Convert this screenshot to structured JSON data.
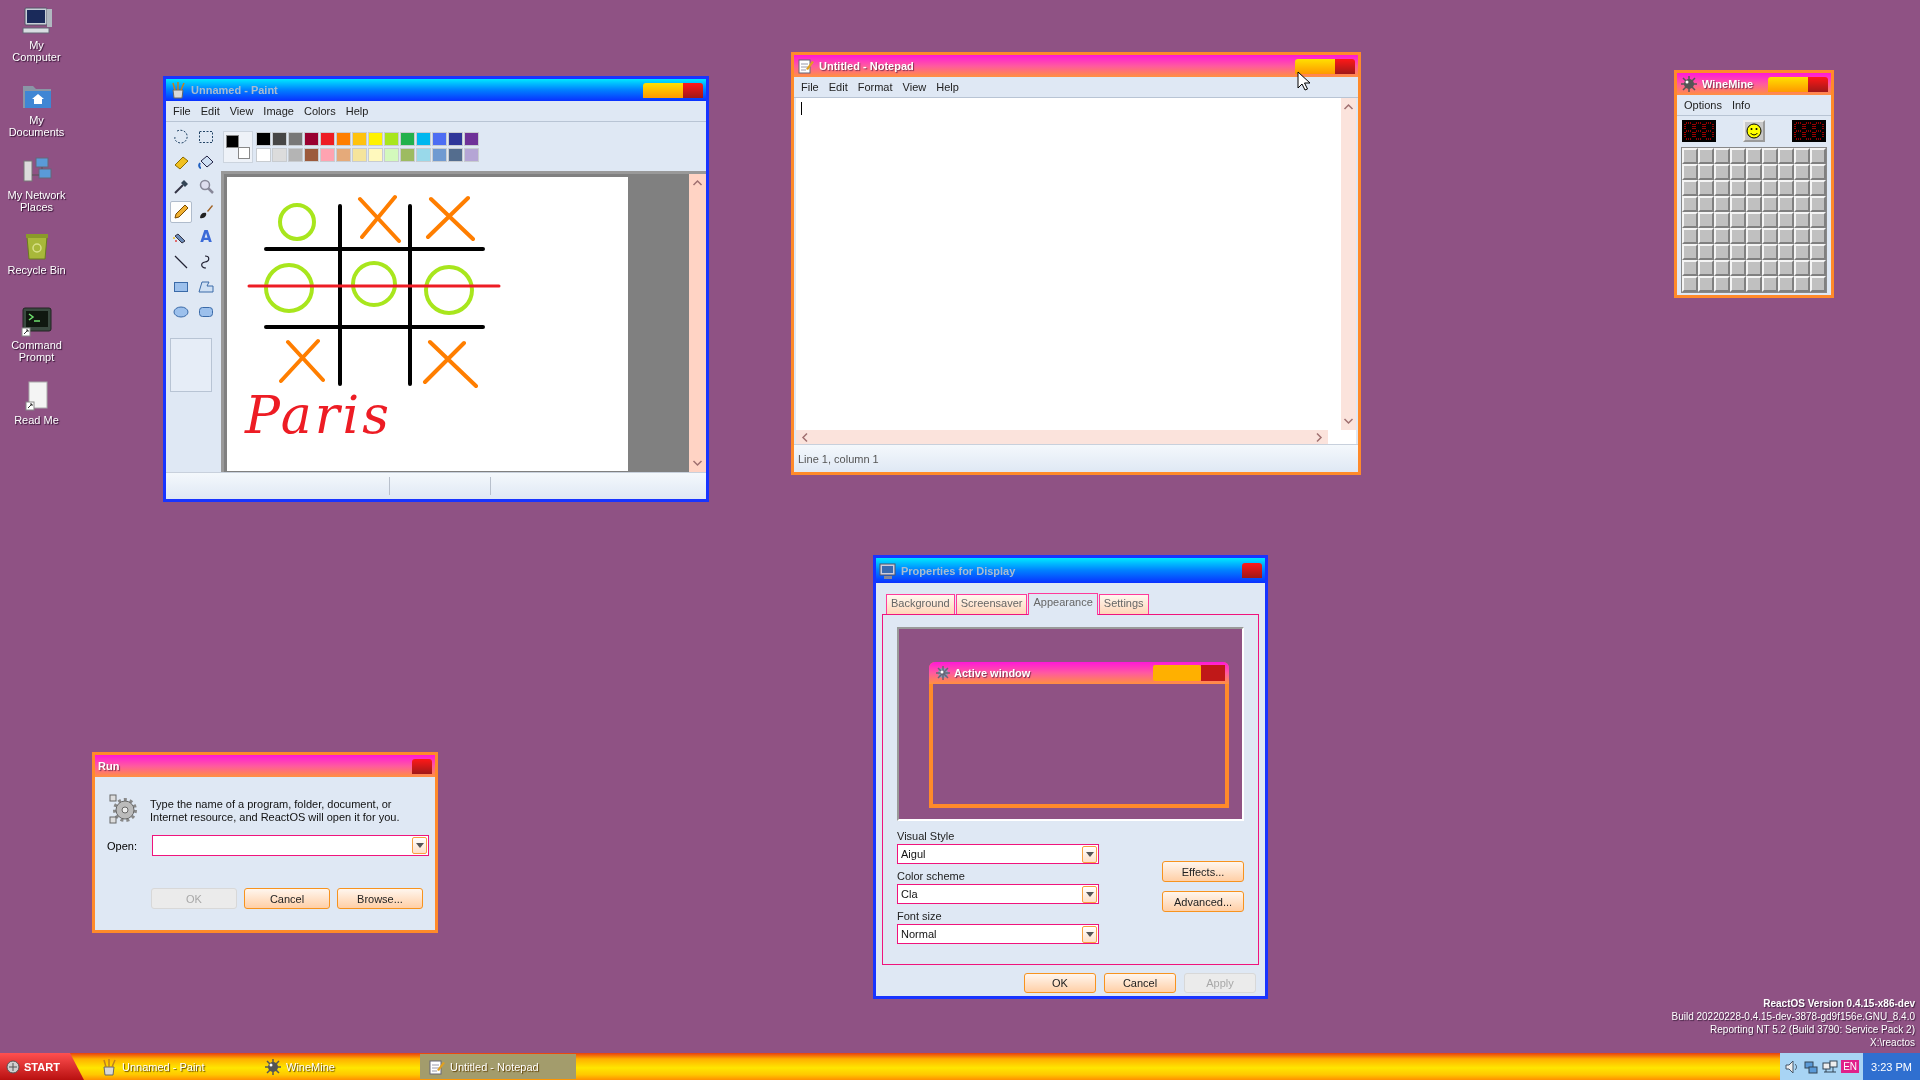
{
  "desktop_icons": [
    {
      "label": "My Computer",
      "kind": "computer"
    },
    {
      "label": "My Documents",
      "kind": "documents"
    },
    {
      "label": "My Network Places",
      "kind": "network"
    },
    {
      "label": "Recycle Bin",
      "kind": "recycle"
    },
    {
      "label": "Command Prompt",
      "kind": "terminal"
    },
    {
      "label": "Read Me",
      "kind": "readme"
    }
  ],
  "windows": [
    {
      "kind": "paint",
      "title": "Unnamed - Paint",
      "active": false,
      "minimize_maximize": true,
      "menu": [
        "File",
        "Edit",
        "View",
        "Image",
        "Colors",
        "Help"
      ],
      "tools": [
        {
          "kind": "free-select",
          "selected": false
        },
        {
          "kind": "rect-select",
          "selected": false
        },
        {
          "kind": "eraser",
          "selected": false
        },
        {
          "kind": "fill",
          "selected": false
        },
        {
          "kind": "picker",
          "selected": false
        },
        {
          "kind": "magnifier",
          "selected": false
        },
        {
          "kind": "pencil",
          "selected": true
        },
        {
          "kind": "brush",
          "selected": false
        },
        {
          "kind": "airbrush",
          "selected": false
        },
        {
          "kind": "text",
          "label": "A",
          "selected": false
        },
        {
          "kind": "line",
          "selected": false
        },
        {
          "kind": "curve",
          "selected": false
        },
        {
          "kind": "rectangle",
          "selected": false
        },
        {
          "kind": "polygon",
          "selected": false
        },
        {
          "kind": "ellipse",
          "selected": false
        },
        {
          "kind": "rounded-rectangle",
          "selected": false
        }
      ],
      "current_colors": [
        {
          "color": "#000000"
        },
        {
          "color": "#ffffff"
        }
      ],
      "palette": [
        {
          "color": "#000000"
        },
        {
          "color": "#464646"
        },
        {
          "color": "#787878"
        },
        {
          "color": "#990030"
        },
        {
          "color": "#ed1c24"
        },
        {
          "color": "#ff7e00"
        },
        {
          "color": "#ffc20e"
        },
        {
          "color": "#fff200"
        },
        {
          "color": "#a8e61d"
        },
        {
          "color": "#22b14c"
        },
        {
          "color": "#00b7ef"
        },
        {
          "color": "#4d6df3"
        },
        {
          "color": "#2f3699"
        },
        {
          "color": "#6f3198"
        },
        {
          "color": "#ffffff"
        },
        {
          "color": "#dcdcdc"
        },
        {
          "color": "#b4b4b4"
        },
        {
          "color": "#9c5a3c"
        },
        {
          "color": "#ffa3b1"
        },
        {
          "color": "#e5aa7a"
        },
        {
          "color": "#f5e49c"
        },
        {
          "color": "#fff9bd"
        },
        {
          "color": "#d3f9bc"
        },
        {
          "color": "#9dbb61"
        },
        {
          "color": "#99d9ea"
        },
        {
          "color": "#709ad1"
        },
        {
          "color": "#546d8e"
        },
        {
          "color": "#b5a5d5"
        }
      ],
      "canvas": {
        "handwriting": "Paris"
      }
    },
    {
      "kind": "notepad",
      "title": "Untitled - Notepad",
      "active": true,
      "minimize_maximize": true,
      "menu": [
        "File",
        "Edit",
        "Format",
        "View",
        "Help"
      ],
      "status": "Line 1, column 1"
    },
    {
      "kind": "minesweeper",
      "title": "WineMine",
      "active": true,
      "minimize_maximize": true,
      "menu": [
        "Options",
        "Info"
      ]
    },
    {
      "kind": "display",
      "title": "Properties for Display",
      "active": false,
      "minimize_maximize": false,
      "tabs": [
        {
          "label": "Background",
          "selected": false
        },
        {
          "label": "Screensaver",
          "selected": false
        },
        {
          "label": "Appearance",
          "selected": true
        },
        {
          "label": "Settings",
          "selected": false
        }
      ],
      "preview": {
        "title": "Active window"
      },
      "fields": [
        {
          "label": "Visual Style",
          "value": "Aigul"
        },
        {
          "label": "Color scheme",
          "value": "Cla"
        },
        {
          "label": "Font size",
          "value": "Normal"
        }
      ],
      "side_buttons": [
        {
          "label": "Effects..."
        },
        {
          "label": "Advanced..."
        }
      ],
      "buttons": [
        {
          "label": "OK",
          "disabled": false
        },
        {
          "label": "Cancel",
          "disabled": false
        },
        {
          "label": "Apply",
          "disabled": true
        }
      ]
    },
    {
      "kind": "run",
      "title": "Run",
      "active": true,
      "minimize_maximize": false,
      "message": "Type the name of a program, folder, document, or Internet resource, and ReactOS will open it for you.",
      "open_label": "Open:",
      "buttons": [
        {
          "label": "OK",
          "disabled": true
        },
        {
          "label": "Cancel",
          "disabled": false
        },
        {
          "label": "Browse...",
          "disabled": false
        }
      ]
    }
  ],
  "taskbar": {
    "start": "START",
    "tasks": [
      {
        "label": "Unnamed - Paint",
        "kind": "paint",
        "selected": false
      },
      {
        "label": "WineMine",
        "kind": "minesweeper",
        "selected": false
      },
      {
        "label": "Untitled - Notepad",
        "kind": "notepad",
        "selected": true
      }
    ],
    "language": "EN",
    "clock": "3:23 PM"
  },
  "version_info": [
    "ReactOS Version 0.4.15-x86-dev",
    "Build 20220228-0.4.15-dev-3878-gd9f156e.GNU_8.4.0",
    "Reporting NT 5.2 (Build 3790: Service Pack 2)",
    "X:\\reactos"
  ]
}
